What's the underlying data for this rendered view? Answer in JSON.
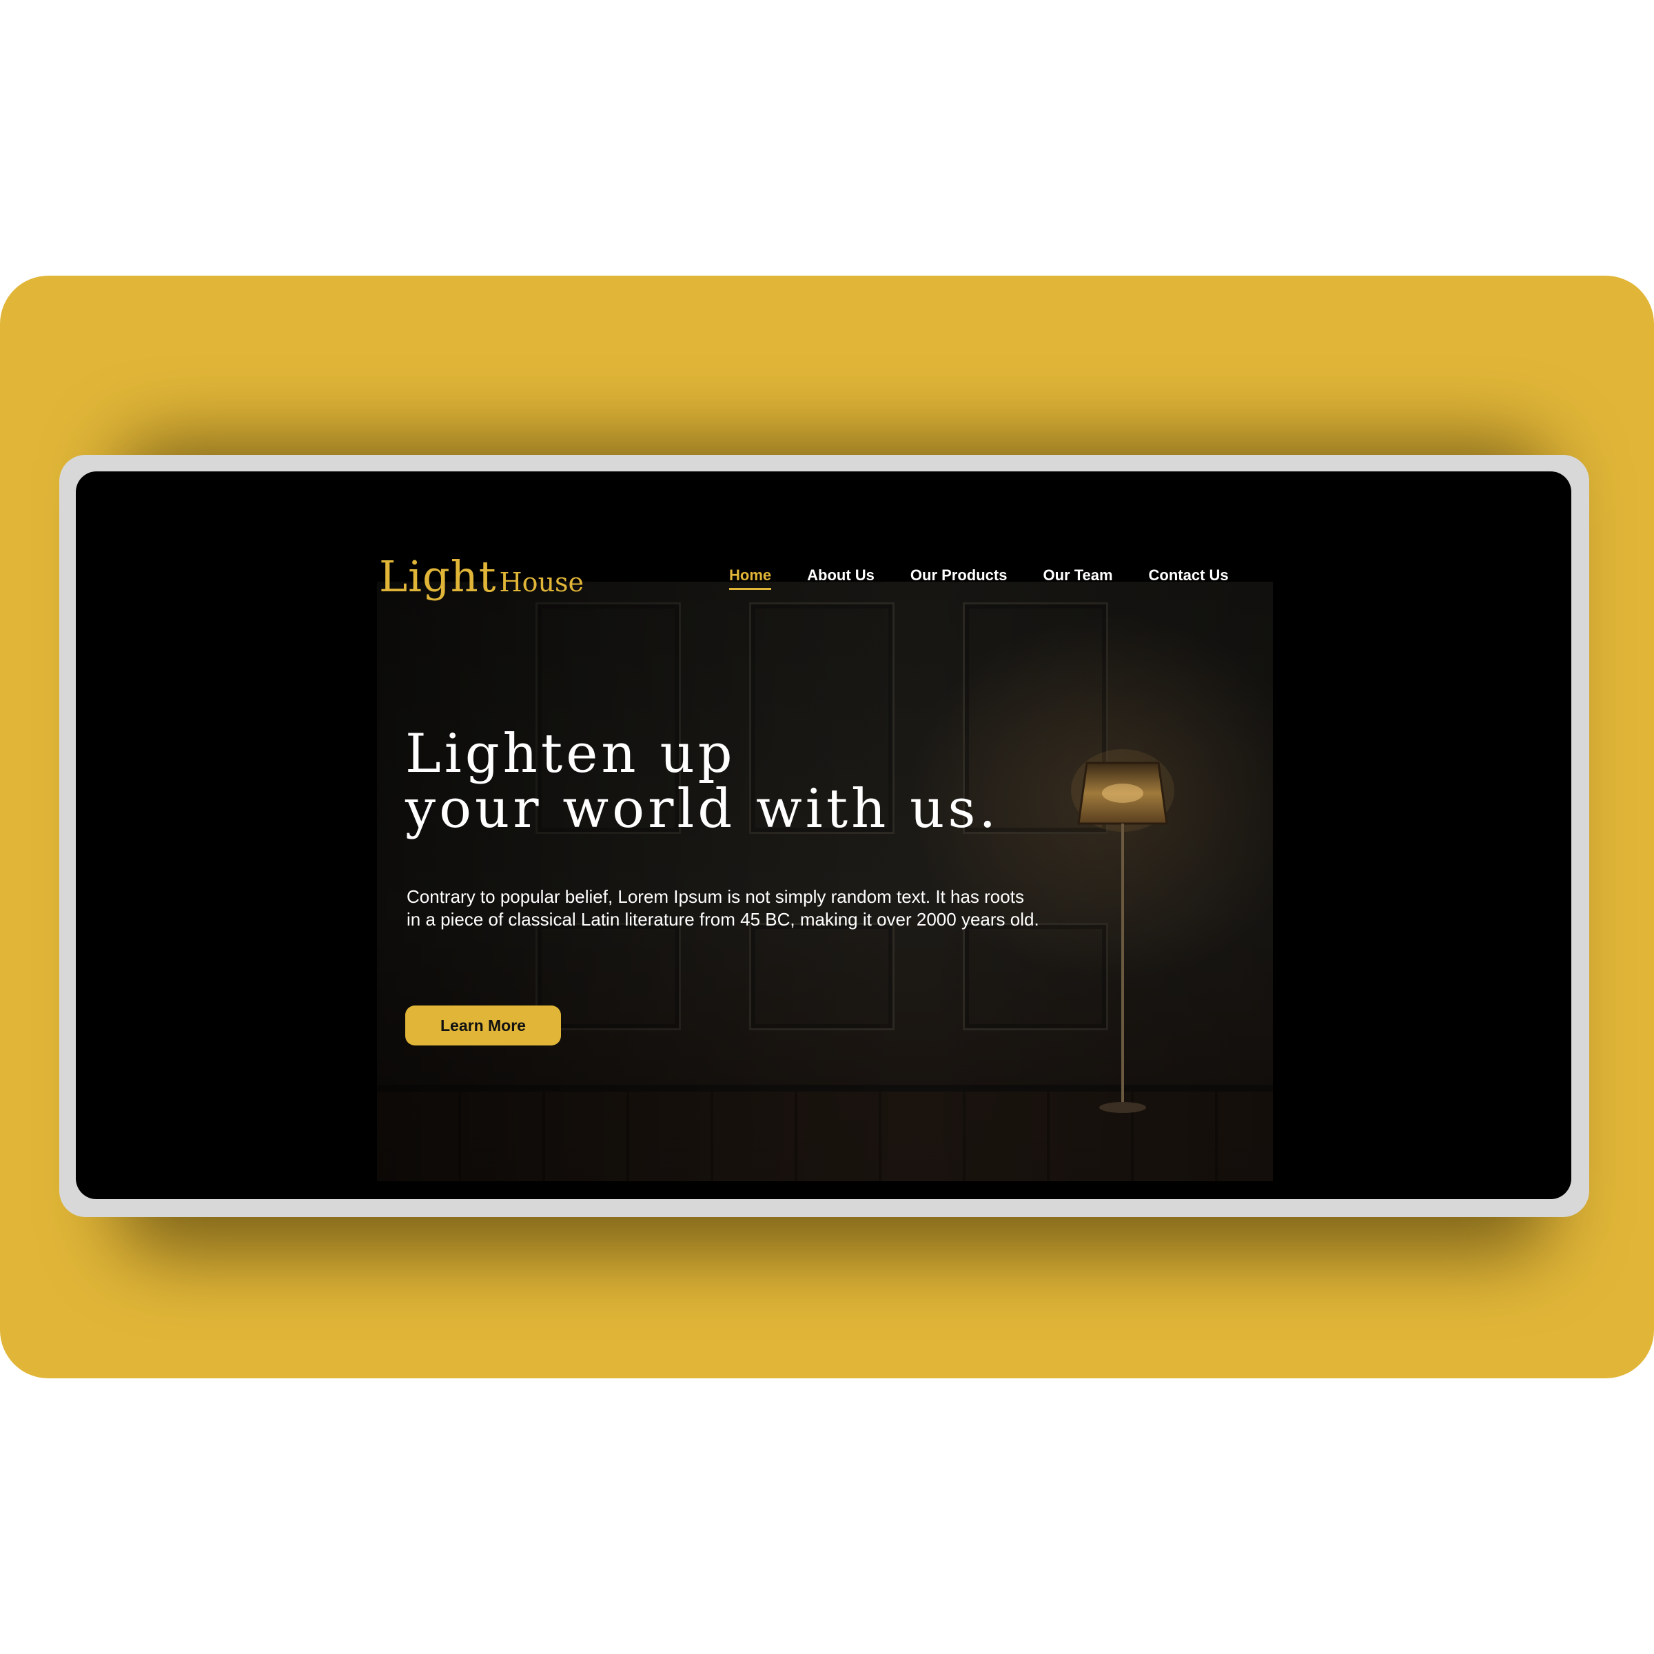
{
  "site": {
    "logo": {
      "primary": "Light",
      "secondary": "House"
    },
    "nav": {
      "items": [
        {
          "label": "Home",
          "active": true
        },
        {
          "label": "About Us",
          "active": false
        },
        {
          "label": "Our Products",
          "active": false
        },
        {
          "label": "Our Team",
          "active": false
        },
        {
          "label": "Contact Us",
          "active": false
        }
      ]
    },
    "hero": {
      "headline_line1": "Lighten up",
      "headline_line2": "your world with us.",
      "body": "Contrary to popular belief, Lorem Ipsum is not simply random text. It has roots in a piece of classical Latin literature from 45 BC, making it over 2000 years old.",
      "cta_label": "Learn More"
    }
  },
  "colors": {
    "accent": "#E1B638",
    "screen_background": "#000000",
    "frame": "#D8D8D8",
    "text": "#FFFFFF"
  },
  "icons": {
    "logo": "lighthouse-logo-icon",
    "hero_image": "floor-lamp-room-image"
  }
}
